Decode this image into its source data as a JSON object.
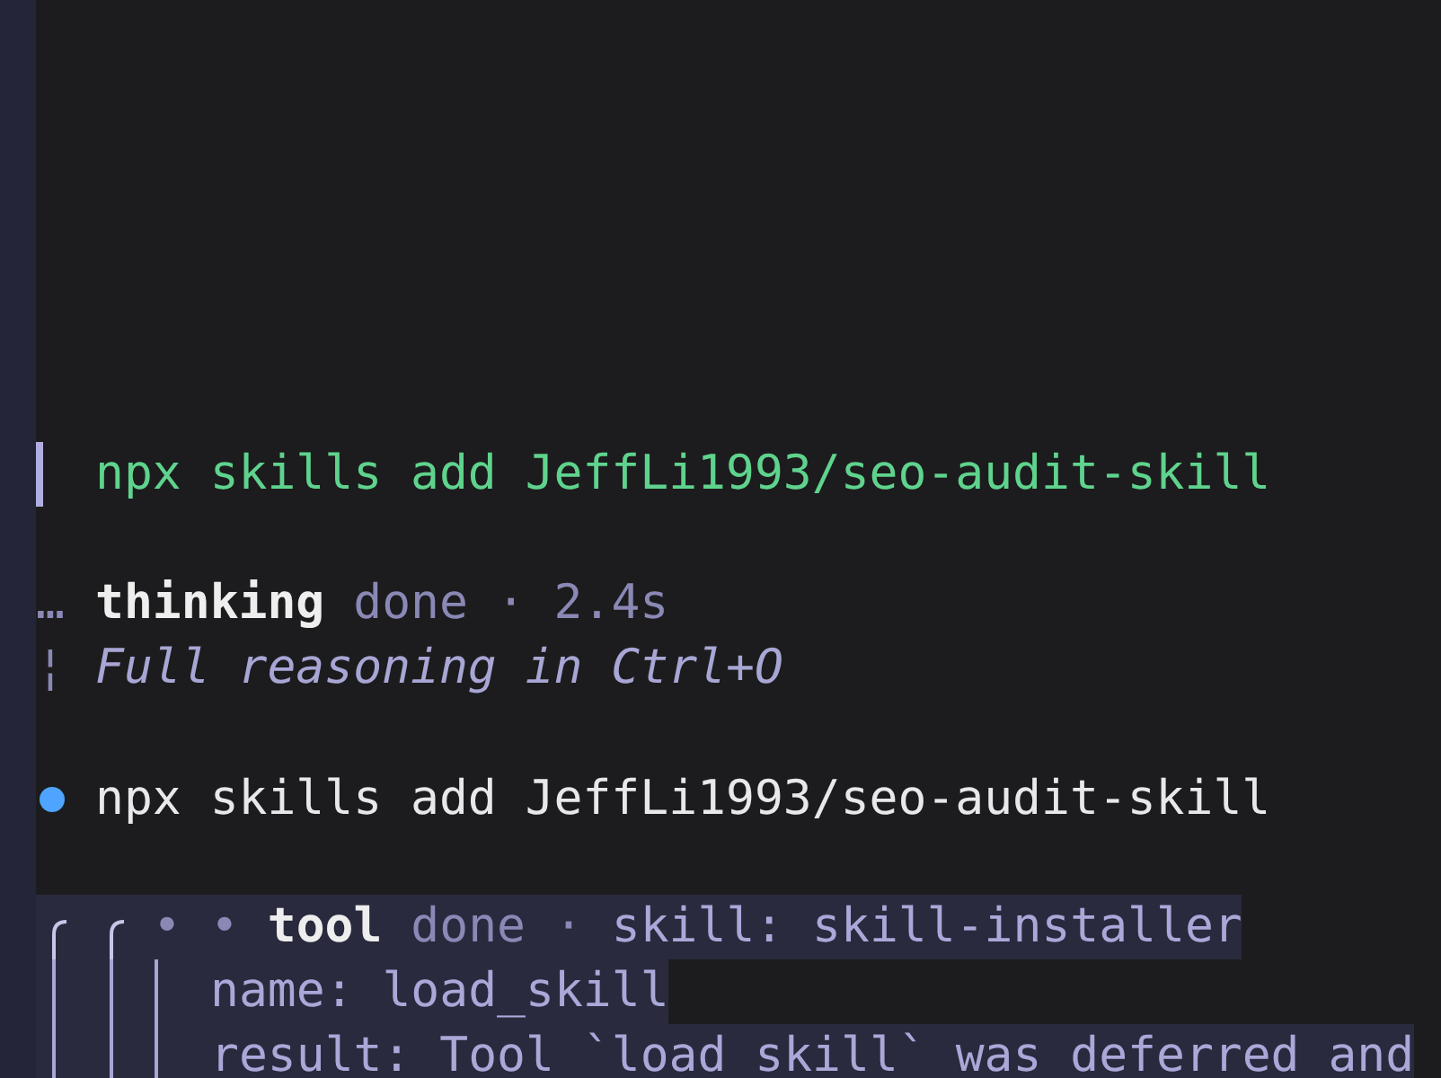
{
  "prompt": {
    "text": "npx skills add JeffLi1993/seo-audit-skill"
  },
  "thinking": {
    "marker": "…",
    "label": "thinking",
    "status": "done · 2.4s",
    "hint_marker": "¦",
    "hint": "Full reasoning in Ctrl+O"
  },
  "command": {
    "text": "npx skills add JeffLi1993/seo-audit-skill"
  },
  "tool": {
    "markers": [
      "•",
      "•"
    ],
    "label": "tool",
    "status": "done ·",
    "detail": "skill: skill-installer",
    "fields": [
      {
        "text": "name: load_skill"
      },
      {
        "text": "result: Tool `load_skill` was deferred and"
      }
    ]
  }
}
